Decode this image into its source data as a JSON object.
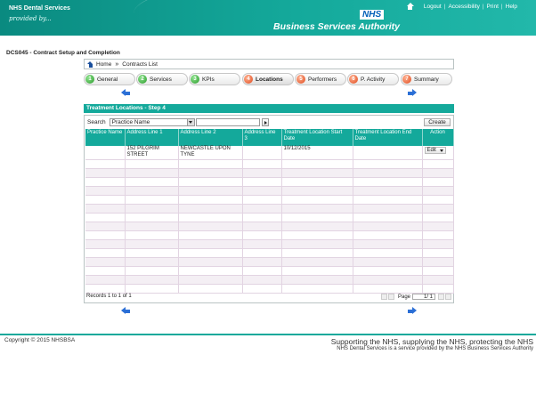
{
  "header": {
    "brand": "NHS Dental Services",
    "provided_by": "provided by...",
    "nhs_logo": "NHS",
    "authority": "Business Services Authority",
    "links": [
      "Logout",
      "Accessibility",
      "Print",
      "Help"
    ]
  },
  "page_title": "DCS045 - Contract Setup and Completion",
  "breadcrumb": {
    "home": "Home",
    "current": "Contracts List"
  },
  "steps": [
    {
      "num": "1",
      "label": "General",
      "status": "complete"
    },
    {
      "num": "2",
      "label": "Services",
      "status": "complete"
    },
    {
      "num": "3",
      "label": "KPIs",
      "status": "complete"
    },
    {
      "num": "4",
      "label": "Locations",
      "status": "current"
    },
    {
      "num": "5",
      "label": "Performers",
      "status": "pending"
    },
    {
      "num": "6",
      "label": "P. Activity",
      "status": "pending"
    },
    {
      "num": "7",
      "label": "Summary",
      "status": "pending"
    }
  ],
  "panel": {
    "title": "Treatment Locations - Step 4",
    "search_label": "Search",
    "search_field_selected": "Practice Name",
    "search_value": "",
    "create_label": "Create",
    "columns": [
      "Practice Name",
      "Address Line 1",
      "Address Line 2",
      "Address Line 3",
      "Treatment Location Start Date",
      "Treatment Location End Date",
      "Action"
    ],
    "rows": [
      {
        "practice_name": "",
        "address1": "152 PILGRIM STREET",
        "address2": "NEWCASTLE UPON TYNE",
        "address3": "",
        "start": "10/12/2015",
        "end": "",
        "action": "Edit"
      }
    ],
    "records": "Records 1 to 1 of 1",
    "page_label": "Page",
    "page_value": "1/ 1"
  },
  "footer": {
    "copyright": "Copyright © 2015 NHSBSA",
    "tagline": "Supporting the NHS, supplying the NHS, protecting the NHS",
    "service_line": "NHS Dental Services is a service provided by the NHS Business Services Authority"
  },
  "colors": {
    "teal": "#14a99b",
    "complete": "#2a9a2a",
    "pending": "#e04a1c",
    "link_blue": "#2b6fd6"
  }
}
